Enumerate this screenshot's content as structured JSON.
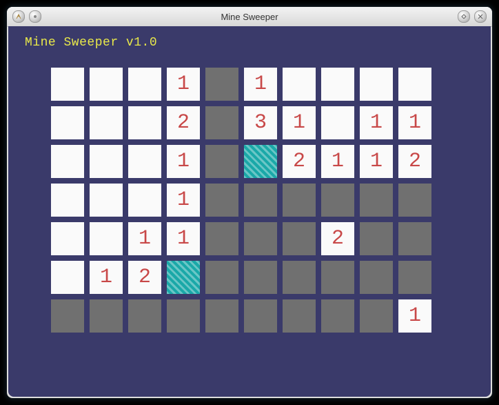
{
  "window": {
    "title": "Mine Sweeper",
    "app_icon": "app-icon",
    "aux_icon": "aux-icon",
    "minimize_icon": "minimize-icon",
    "close_icon": "close-icon"
  },
  "heading": "Mine Sweeper v1.0",
  "grid": {
    "rows": 7,
    "cols": 10,
    "cells": [
      [
        "c",
        "c",
        "c",
        "1",
        "r",
        "1",
        "c",
        "c",
        "c",
        "c"
      ],
      [
        "c",
        "c",
        "c",
        "2",
        "r",
        "3",
        "1",
        "c",
        "1",
        "1"
      ],
      [
        "c",
        "c",
        "c",
        "1",
        "r",
        "f",
        "2",
        "1",
        "1",
        "2",
        "f"
      ],
      [
        "c",
        "c",
        "c",
        "1",
        "r",
        "r",
        "r",
        "r",
        "r",
        "r"
      ],
      [
        "c",
        "c",
        "1",
        "1",
        "r",
        "r",
        "r",
        "2",
        "r",
        "r"
      ],
      [
        "c",
        "1",
        "2",
        "f",
        "r",
        "r",
        "r",
        "r",
        "r",
        "r"
      ],
      [
        "r",
        "r",
        "r",
        "r",
        "r",
        "r",
        "r",
        "r",
        "r",
        "1"
      ]
    ]
  }
}
